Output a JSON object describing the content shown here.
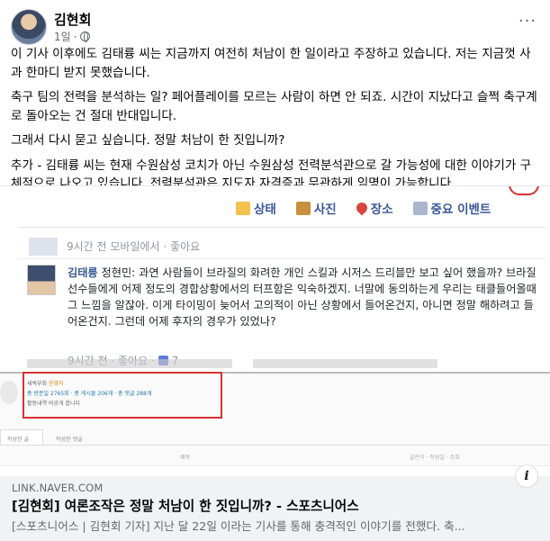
{
  "post": {
    "author": "김현회",
    "time": "1일",
    "more_icon": "···",
    "paragraphs": [
      "이 기사 이후에도 김태륭 씨는 지금까지 여전히 처남이 한 일이라고 주장하고 있습니다. 저는 지금껏 사과 한마디 받지 못했습니다.",
      "축구 팀의 전력을 분석하는 일? 페어플레이를 모르는 사람이 하면 안 되죠. 시간이 지났다고 슬쩍 축구계로 돌아오는 건 절대 반대입니다.",
      "그래서 다시 묻고 싶습니다. 정말 처남이 한 짓입니까?",
      "추가 - 김태륭 씨는 현재 수원삼성 코치가 아닌 수원삼성 전력분석관으로 갈 가능성에 대한 이야기가 구체적으로 나오고 있습니다. 전력분석관은 지도자 자격증과 무관하게 임명이 가능합니다."
    ]
  },
  "screenshot": {
    "tabs": [
      {
        "label": "상태",
        "icon": "status-icon"
      },
      {
        "label": "사진",
        "icon": "photo-icon"
      },
      {
        "label": "장소",
        "icon": "place-icon"
      },
      {
        "label": "중요 이벤트",
        "icon": "event-icon"
      }
    ],
    "row1_text": "9시간 전 모바일에서 · 좋아요",
    "comment": {
      "name": "김태륭",
      "text": "정현민: 과연 사람들이 브라질의 화려한 개인 스킬과 시저스 드리블만 보고 싶어 했을까? 브라질 선수들에게 어제 정도의 경합상황에서의 터프함은 익숙하겠지. 너말에 동의하는게 우리는 태클들어올때 그 느낌을 알잖아. 이게 타이밍이 늦어서 고의적이 아닌 상황에서 들어온건지, 아니면 정말 해하려고 들어온건지. 그런데 어제 후자의 경우가 있었나?",
      "meta": "9시간 전 · 좋아요 ·",
      "likes": "7"
    },
    "panel": {
      "line1_a": "새싹부회",
      "line1_b": "운영자",
      "line2": "총 방문일 2765회 · 총 게시물 206개 · 총 댓글 288개",
      "line3": "활동내역 비공개 합니다",
      "tab1": "작성한 글",
      "tab2": "작성한 댓글",
      "row_left": "제목",
      "row_right": "글쓴이 · 작성일 · 조회"
    }
  },
  "link": {
    "domain": "LINK.NAVER.COM",
    "title": "[김현회] 여론조작은 정말 처남이 한 짓입니까? - 스포츠니어스",
    "description": "[스포츠니어스 | 김현회 기자] 지난 달 22일 이라는 기사를 통해 충격적인 이야기를 전했다. 축...",
    "info_icon": "i"
  }
}
